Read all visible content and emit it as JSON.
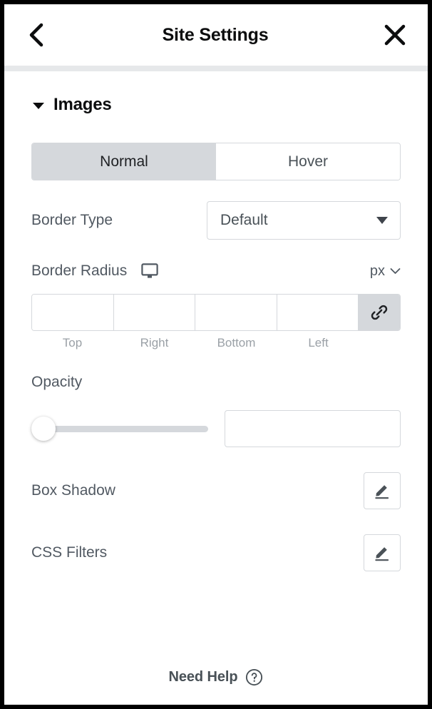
{
  "header": {
    "back_icon": "chevron-left-icon",
    "title": "Site Settings",
    "close_icon": "close-icon"
  },
  "section": {
    "caret_icon": "caret-down-icon",
    "title": "Images"
  },
  "state_tabs": {
    "items": [
      {
        "label": "Normal",
        "active": true
      },
      {
        "label": "Hover",
        "active": false
      }
    ]
  },
  "controls": {
    "border_type": {
      "label": "Border Type",
      "value": "Default",
      "caret_icon": "caret-down-icon"
    },
    "border_radius": {
      "label": "Border Radius",
      "device_icon": "desktop-monitor-icon",
      "unit": "px",
      "unit_caret_icon": "chevron-down-icon",
      "link_icon": "link-chain-icon",
      "values": [
        "",
        "",
        "",
        ""
      ],
      "side_labels": [
        "Top",
        "Right",
        "Bottom",
        "Left"
      ]
    },
    "opacity": {
      "label": "Opacity",
      "value": "",
      "slider_percent": 0
    },
    "box_shadow": {
      "label": "Box Shadow",
      "edit_icon": "pencil-edit-icon"
    },
    "css_filters": {
      "label": "CSS Filters",
      "edit_icon": "pencil-edit-icon"
    }
  },
  "footer": {
    "label": "Need Help",
    "help_icon": "question-circle-icon"
  },
  "colors": {
    "accent_gray": "#d5d8dc",
    "label_text": "#515962",
    "title_text": "#0c0d0e",
    "divider": "#e6e8ea"
  }
}
